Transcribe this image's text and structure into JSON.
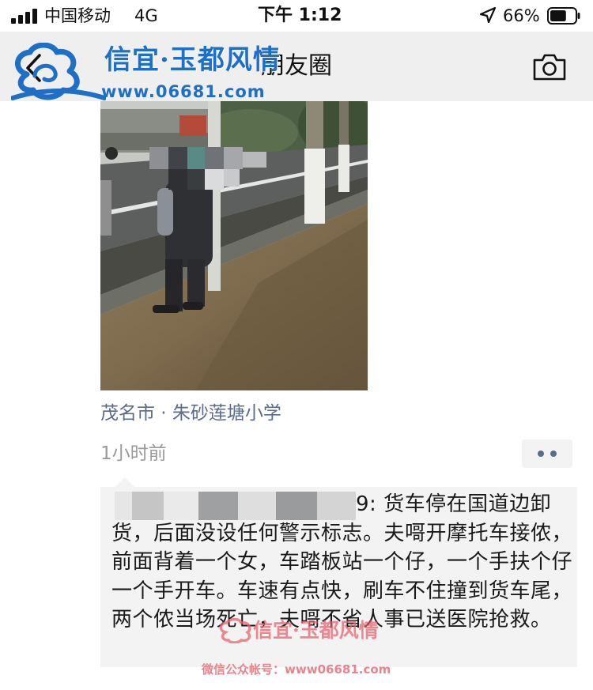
{
  "status_bar": {
    "carrier": "中国移动",
    "network": "4G",
    "time": "下午 1:12",
    "battery_percent": "66%",
    "battery_level": 0.66,
    "signal_bars": 4
  },
  "nav": {
    "title": "朋友圈",
    "back_icon": "chevron-left-icon",
    "camera_icon": "camera-icon"
  },
  "watermark": {
    "site_name": "信宜·玉都风情",
    "site_url": "www.06681.com",
    "bottom_name": "信宜·玉都风情",
    "bottom_caption": "微信公众帐号：www06681.com"
  },
  "post": {
    "location": "茂名市 · 朱砂莲塘小学",
    "time_ago": "1小时前",
    "more_icon": "more-dots-icon"
  },
  "comment": {
    "text": "9: 货车停在国道边卸货，后面没设任何警示标志。夫𠹭开摩托车接侬，前面背着一个女，车踏板站一个仔，一个手扶个仔一个手开车。车速有点快，刷车不住撞到货车尾，两个侬当场死亡，夫𠹭不省人事已送医院抢救。"
  },
  "colors": {
    "nav_background": "#efefef",
    "link_blue": "#5b6b8b",
    "muted_gray": "#9a9a9a",
    "comment_background": "#f3f3f3",
    "watermark_blue": "#1d6fc7"
  }
}
